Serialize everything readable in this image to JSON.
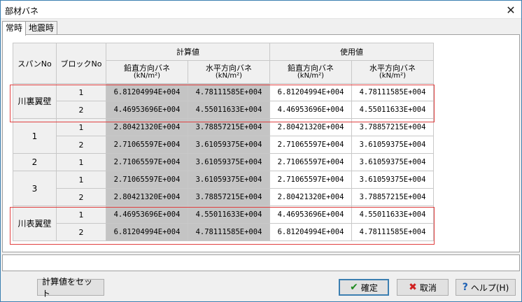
{
  "window": {
    "title": "部材バネ",
    "close_glyph": "✕"
  },
  "tabs": [
    {
      "label": "常時",
      "active": true
    },
    {
      "label": "地震時",
      "active": false
    }
  ],
  "table": {
    "header": {
      "span_no": "スパンNo",
      "block_no": "ブロックNo",
      "calc_group": "計算値",
      "use_group": "使用値",
      "vertical": "鉛直方向バネ",
      "horizontal": "水平方向バネ",
      "unit": "(kN/m²)"
    },
    "groups": [
      {
        "span": "川裏翼壁",
        "rows": [
          {
            "block": "1",
            "calc_v": "6.81204994E+004",
            "calc_h": "4.78111585E+004",
            "use_v": "6.81204994E+004",
            "use_h": "4.78111585E+004"
          },
          {
            "block": "2",
            "calc_v": "4.46953696E+004",
            "calc_h": "4.55011633E+004",
            "use_v": "4.46953696E+004",
            "use_h": "4.55011633E+004"
          }
        ]
      },
      {
        "span": "1",
        "rows": [
          {
            "block": "1",
            "calc_v": "2.80421320E+004",
            "calc_h": "3.78857215E+004",
            "use_v": "2.80421320E+004",
            "use_h": "3.78857215E+004"
          },
          {
            "block": "2",
            "calc_v": "2.71065597E+004",
            "calc_h": "3.61059375E+004",
            "use_v": "2.71065597E+004",
            "use_h": "3.61059375E+004"
          }
        ]
      },
      {
        "span": "2",
        "rows": [
          {
            "block": "1",
            "calc_v": "2.71065597E+004",
            "calc_h": "3.61059375E+004",
            "use_v": "2.71065597E+004",
            "use_h": "3.61059375E+004"
          }
        ]
      },
      {
        "span": "3",
        "rows": [
          {
            "block": "1",
            "calc_v": "2.71065597E+004",
            "calc_h": "3.61059375E+004",
            "use_v": "2.71065597E+004",
            "use_h": "3.61059375E+004"
          },
          {
            "block": "2",
            "calc_v": "2.80421320E+004",
            "calc_h": "3.78857215E+004",
            "use_v": "2.80421320E+004",
            "use_h": "3.78857215E+004"
          }
        ]
      },
      {
        "span": "川表翼壁",
        "rows": [
          {
            "block": "1",
            "calc_v": "4.46953696E+004",
            "calc_h": "4.55011633E+004",
            "use_v": "4.46953696E+004",
            "use_h": "4.55011633E+004"
          },
          {
            "block": "2",
            "calc_v": "6.81204994E+004",
            "calc_h": "4.78111585E+004",
            "use_v": "6.81204994E+004",
            "use_h": "4.78111585E+004"
          }
        ]
      }
    ]
  },
  "buttons": {
    "set_calc": "計算値をセット",
    "ok": "確定",
    "cancel": "取消",
    "help": "ヘルプ(H)"
  },
  "colors": {
    "highlight_border": "#e04040",
    "calc_cell_bg": "#c4c4c4"
  }
}
